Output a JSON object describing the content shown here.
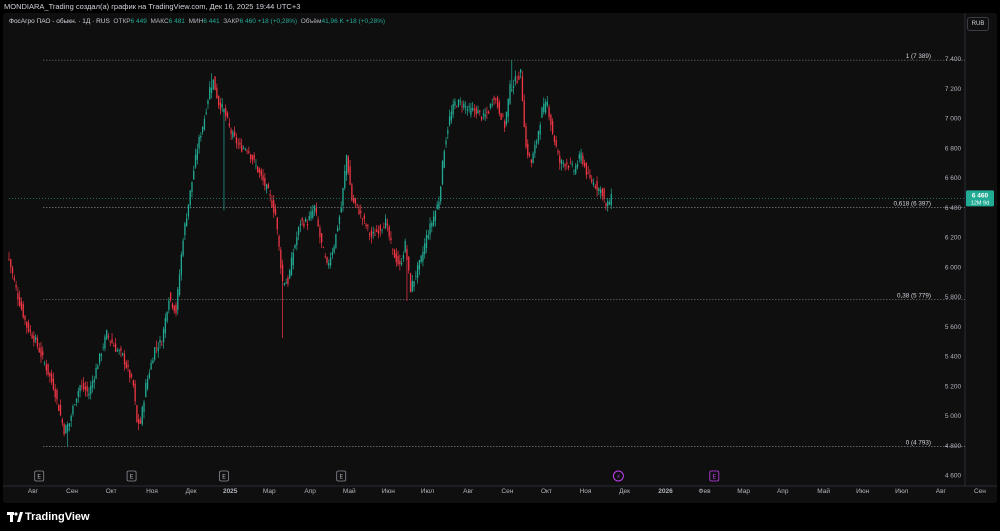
{
  "header": {
    "caption": "MONDIARA_Trading создал(а) график на TradingView.com, Дек 16, 2025 19:44 UTC+3"
  },
  "legend": {
    "symbol": "ФосАгро ПАО - обыкн. · 1Д · RUS",
    "open_label": "ОТКР",
    "open_value": "6 449",
    "high_label": "МАКС",
    "high_value": "6 481",
    "low_label": "МИН",
    "low_value": "6 441",
    "close_label": "ЗАКР",
    "close_value": "6 460 +18 (+0,28%)",
    "volume_label": "Объём",
    "volume_value": "41,96 K +18 (+0,28%)"
  },
  "currency_button": "RUB",
  "footer": {
    "brand": "TradingView"
  },
  "colors": {
    "up": "#22ab94",
    "down": "#f23645",
    "background": "#0f0f0f",
    "last_price_bg": "#22ab94"
  },
  "chart_data": {
    "type": "candlestick",
    "title": "ФосАгро ПАО - обыкн. · 1Д · RUS",
    "y_range": [
      4600,
      7450
    ],
    "y_ticks": [
      4600,
      4800,
      5000,
      5200,
      5400,
      5600,
      5800,
      6000,
      6200,
      6400,
      6600,
      6800,
      7000,
      7200,
      7400
    ],
    "y_tick_labels": [
      "4 600",
      "4 800",
      "5 000",
      "5 200",
      "5 400",
      "5 600",
      "5 800",
      "6 000",
      "6 200",
      "6 400",
      "6 600",
      "6 800",
      "7 000",
      "7 200",
      "7 400"
    ],
    "x_ticks": [
      "Авг",
      "Сен",
      "Окт",
      "Ноя",
      "Дек",
      "2025",
      "Мар",
      "Апр",
      "Май",
      "Июн",
      "Июл",
      "Авг",
      "Сен",
      "Окт",
      "Ноя",
      "Дек",
      "2026",
      "Фев",
      "Мар",
      "Апр",
      "Май",
      "Июн",
      "Июл",
      "Авг",
      "Сен"
    ],
    "x_tick_index": [
      0,
      22,
      44,
      67,
      89,
      111,
      133,
      156,
      178,
      200,
      222,
      245,
      267,
      289,
      311,
      333,
      356,
      378,
      400,
      422,
      445,
      467,
      489,
      511,
      533
    ],
    "last_index": 339,
    "series_path": [
      [
        0,
        6050
      ],
      [
        5,
        5800
      ],
      [
        10,
        5600
      ],
      [
        15,
        5500
      ],
      [
        20,
        5350
      ],
      [
        25,
        5200
      ],
      [
        28,
        5050
      ],
      [
        31,
        4900
      ],
      [
        34,
        4950
      ],
      [
        37,
        5100
      ],
      [
        40,
        5200
      ],
      [
        45,
        5150
      ],
      [
        50,
        5350
      ],
      [
        55,
        5550
      ],
      [
        60,
        5450
      ],
      [
        64,
        5400
      ],
      [
        67,
        5300
      ],
      [
        70,
        5200
      ],
      [
        72,
        4950
      ],
      [
        74,
        4950
      ],
      [
        77,
        5200
      ],
      [
        82,
        5450
      ],
      [
        86,
        5500
      ],
      [
        90,
        5800
      ],
      [
        94,
        5700
      ],
      [
        98,
        6200
      ],
      [
        102,
        6500
      ],
      [
        106,
        6800
      ],
      [
        110,
        7000
      ],
      [
        113,
        7200
      ],
      [
        115,
        7250
      ],
      [
        118,
        7100
      ],
      [
        121,
        7050
      ],
      [
        125,
        6900
      ],
      [
        130,
        6800
      ],
      [
        134,
        6800
      ],
      [
        138,
        6700
      ],
      [
        142,
        6600
      ],
      [
        146,
        6500
      ],
      [
        150,
        6350
      ],
      [
        154,
        5900
      ],
      [
        157,
        5900
      ],
      [
        160,
        6100
      ],
      [
        164,
        6300
      ],
      [
        168,
        6300
      ],
      [
        172,
        6400
      ],
      [
        175,
        6200
      ],
      [
        179,
        6000
      ],
      [
        183,
        6150
      ],
      [
        187,
        6400
      ],
      [
        190,
        6750
      ],
      [
        193,
        6450
      ],
      [
        196,
        6400
      ],
      [
        200,
        6300
      ],
      [
        204,
        6200
      ],
      [
        208,
        6250
      ],
      [
        212,
        6300
      ],
      [
        216,
        6100
      ],
      [
        220,
        6000
      ],
      [
        223,
        6150
      ],
      [
        226,
        5850
      ],
      [
        229,
        5950
      ],
      [
        232,
        6050
      ],
      [
        235,
        6200
      ],
      [
        238,
        6300
      ],
      [
        242,
        6450
      ],
      [
        245,
        6800
      ],
      [
        248,
        7000
      ],
      [
        251,
        7100
      ],
      [
        255,
        7100
      ],
      [
        259,
        7050
      ],
      [
        263,
        7050
      ],
      [
        267,
        7000
      ],
      [
        270,
        7050
      ],
      [
        273,
        7150
      ],
      [
        276,
        7050
      ],
      [
        279,
        6950
      ],
      [
        282,
        7200
      ],
      [
        285,
        7250
      ],
      [
        288,
        7300
      ],
      [
        291,
        6800
      ],
      [
        294,
        6700
      ],
      [
        297,
        6850
      ],
      [
        300,
        7050
      ],
      [
        303,
        7100
      ],
      [
        306,
        6900
      ],
      [
        310,
        6700
      ],
      [
        314,
        6700
      ],
      [
        318,
        6650
      ],
      [
        322,
        6750
      ],
      [
        326,
        6600
      ],
      [
        330,
        6550
      ],
      [
        334,
        6500
      ],
      [
        336,
        6400
      ],
      [
        339,
        6460
      ]
    ],
    "wick_extremes": [
      [
        0,
        6100
      ],
      [
        33,
        4790
      ],
      [
        114,
        7300
      ],
      [
        121,
        6380
      ],
      [
        154,
        5520
      ],
      [
        224,
        5770
      ],
      [
        283,
        7390
      ],
      [
        336,
        6380
      ]
    ],
    "fib_levels": [
      {
        "label": "1 (7 389)",
        "value": 7389
      },
      {
        "label": "0,618 (6 397)",
        "value": 6397
      },
      {
        "label": "0,38 (5 779)",
        "value": 5779
      },
      {
        "label": "0 (4 793)",
        "value": 4793
      }
    ],
    "last_price": {
      "value": 6460,
      "label": "6 460",
      "countdown": "12M 9d"
    },
    "event_markers": [
      {
        "index": 17,
        "label": "E"
      },
      {
        "index": 69,
        "label": "E"
      },
      {
        "index": 121,
        "label": "E"
      },
      {
        "index": 187,
        "label": "E"
      },
      {
        "index": 343,
        "label": "⚡"
      },
      {
        "index": 397,
        "label": "E"
      }
    ]
  }
}
